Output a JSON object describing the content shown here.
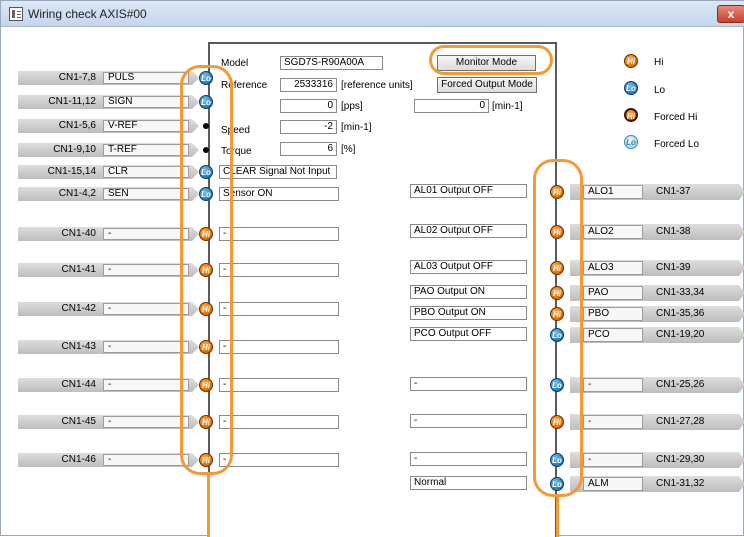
{
  "window": {
    "title": "Wiring check AXIS#00",
    "close_label": "x"
  },
  "monitor": {
    "model_label": "Model",
    "model_value": "SGD7S-R90A00A",
    "monitor_mode_button": "Monitor Mode",
    "reference_label": "Reference",
    "reference_value": "2533316",
    "reference_unit": "[reference units]",
    "forced_output_button": "Forced Output Mode",
    "pps_value": "0",
    "pps_unit": "[pps]",
    "min_value": "0",
    "min_unit": "[min-1]",
    "speed_label": "Speed",
    "speed_value": "-2",
    "speed_unit": "[min-1]",
    "torque_label": "Torque",
    "torque_value": "6",
    "torque_unit": "[%]"
  },
  "legend": [
    {
      "icon": "Hi",
      "label": "Hi"
    },
    {
      "icon": "Lo",
      "label": "Lo"
    },
    {
      "icon": "Hi",
      "label": "Forced Hi"
    },
    {
      "icon": "Lo",
      "label": "Forced Lo"
    }
  ],
  "inputs": [
    {
      "pin": "CN1-7,8",
      "signal": "PULS",
      "led": "Lo",
      "status": ""
    },
    {
      "pin": "CN1-11,12",
      "signal": "SIGN",
      "led": "Lo",
      "status": ""
    },
    {
      "pin": "CN1-5,6",
      "signal": "V-REF",
      "led": "",
      "status": ""
    },
    {
      "pin": "CN1-9,10",
      "signal": "T-REF",
      "led": "",
      "status": ""
    },
    {
      "pin": "CN1-15,14",
      "signal": "CLR",
      "led": "Lo",
      "status": "CLEAR Signal Not Input"
    },
    {
      "pin": "CN1-4,2",
      "signal": "SEN",
      "led": "Lo",
      "status": "Sensor ON"
    },
    {
      "pin": "CN1-40",
      "signal": "-",
      "led": "Hi",
      "status": "-"
    },
    {
      "pin": "CN1-41",
      "signal": "-",
      "led": "Hi",
      "status": "-"
    },
    {
      "pin": "CN1-42",
      "signal": "-",
      "led": "Hi",
      "status": "-"
    },
    {
      "pin": "CN1-43",
      "signal": "-",
      "led": "Hi",
      "status": "-"
    },
    {
      "pin": "CN1-44",
      "signal": "-",
      "led": "Hi",
      "status": "-"
    },
    {
      "pin": "CN1-45",
      "signal": "-",
      "led": "Hi",
      "status": "-"
    },
    {
      "pin": "CN1-46",
      "signal": "-",
      "led": "Hi",
      "status": "-"
    }
  ],
  "outputs": [
    {
      "status": "AL01 Output OFF",
      "led": "Hi",
      "signal": "ALO1",
      "pin": "CN1-37"
    },
    {
      "status": "AL02 Output OFF",
      "led": "Hi",
      "signal": "ALO2",
      "pin": "CN1-38"
    },
    {
      "status": "AL03 Output OFF",
      "led": "Hi",
      "signal": "ALO3",
      "pin": "CN1-39"
    },
    {
      "status": "PAO Output ON",
      "led": "Hi",
      "signal": "PAO",
      "pin": "CN1-33,34"
    },
    {
      "status": "PBO Output ON",
      "led": "Hi",
      "signal": "PBO",
      "pin": "CN1-35,36"
    },
    {
      "status": "PCO Output OFF",
      "led": "Lo",
      "signal": "PCO",
      "pin": "CN1-19,20"
    },
    {
      "status": "-",
      "led": "Lo",
      "signal": "-",
      "pin": "CN1-25,26"
    },
    {
      "status": "-",
      "led": "Hi",
      "signal": "-",
      "pin": "CN1-27,28"
    },
    {
      "status": "-",
      "led": "Lo",
      "signal": "-",
      "pin": "CN1-29,30"
    },
    {
      "status": "Normal",
      "led": "Lo",
      "signal": "ALM",
      "pin": "CN1-31,32"
    }
  ],
  "colors": {
    "hi": "#e06b00",
    "lo": "#1f78b5",
    "highlight": "#f39a37"
  }
}
